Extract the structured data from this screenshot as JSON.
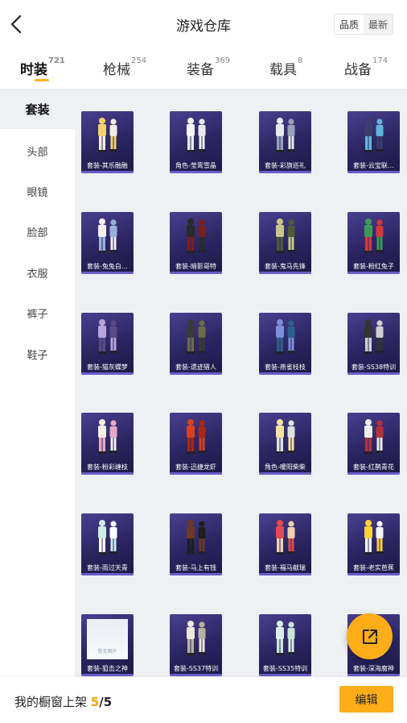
{
  "header": {
    "title": "游戏仓库",
    "sort_quality": "品质",
    "sort_newest": "最新"
  },
  "tabs": [
    {
      "label": "时装",
      "count": "721"
    },
    {
      "label": "枪械",
      "count": "254"
    },
    {
      "label": "装备",
      "count": "369"
    },
    {
      "label": "载具",
      "count": "8"
    },
    {
      "label": "战备",
      "count": "174"
    }
  ],
  "sidebar": [
    "套装",
    "头部",
    "眼镜",
    "脸部",
    "衣服",
    "裤子",
    "鞋子"
  ],
  "items": [
    "套装-其乐融融",
    "角色-莹鸾雪晶",
    "套装-彩旗巡礼",
    "套装-云宝联…",
    "套装-兔兔白…",
    "套装-暗影哥特",
    "套装-鬼马先锋",
    "套装-粉红兔子",
    "套装-猫灰蝶梦",
    "套装-遗迹猎人",
    "套装-燕雀枝枝",
    "套装-SS38特训",
    "套装-粉彩缠枝",
    "套装-迅捷龙虾",
    "角色-暖阳柴柴",
    "套装-红鹊青花",
    "套装-雨过天青",
    "套装-马上有钱",
    "套装-福马献瑞",
    "套装-老实芭蕉",
    "套装-狙击之神",
    "套装-SS37特训",
    "套装-SS35特训",
    "套装-深海腐神"
  ],
  "placeholder_text": "暂无图片",
  "colors": {
    "accent": "#ffae1a",
    "card_bg": "#2a2460",
    "content_bg": "#eef0f4"
  },
  "footer": {
    "label": "我的橱窗上架",
    "count": "5",
    "separator": "/",
    "total": "5",
    "edit_label": "编辑"
  },
  "icons": {
    "back": "chevron-left-icon",
    "fab": "share-external-icon"
  }
}
